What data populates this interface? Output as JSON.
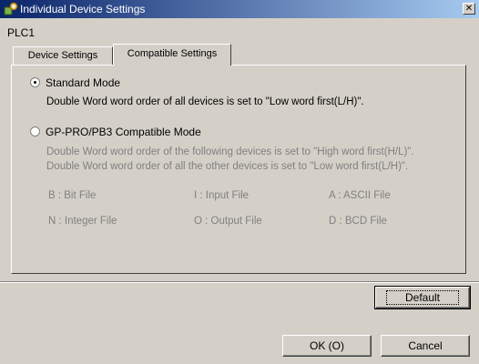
{
  "window": {
    "title": "Individual Device Settings",
    "close_glyph": "✕",
    "icon": "device-settings-icon"
  },
  "device_name": "PLC1",
  "tabs": [
    {
      "label": "Device Settings",
      "active": false
    },
    {
      "label": "Compatible Settings",
      "active": true
    }
  ],
  "options": {
    "standard": {
      "label": "Standard Mode",
      "selected": true,
      "description": "Double Word word order of all devices is set to \"Low word first(L/H)\"."
    },
    "compatible": {
      "label": "GP-PRO/PB3 Compatible Mode",
      "selected": false,
      "description_1": "Double Word word order of the following devices is set to \"High word first(H/L)\".",
      "description_2": "Double Word word order of all the other devices is set to \"Low word first(L/H)\"."
    }
  },
  "devices": [
    [
      "B : Bit File",
      "I : Input File",
      "A : ASCII File"
    ],
    [
      "N : Integer File",
      "O : Output File",
      "D : BCD File"
    ]
  ],
  "buttons": {
    "default_label": "Default",
    "ok_label": "OK (O)",
    "cancel_label": "Cancel"
  }
}
